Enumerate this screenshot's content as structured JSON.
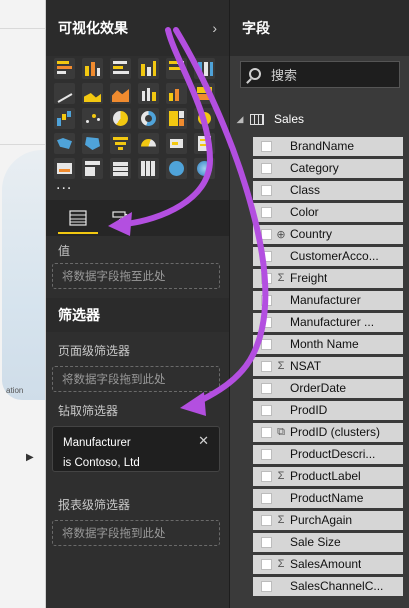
{
  "visualizations": {
    "title": "可视化效果",
    "more": "...",
    "values_label": "值",
    "values_drop": "将数据字段拖至此处",
    "filters_title": "筛选器",
    "page_filters_label": "页面级筛选器",
    "page_filters_drop": "将数据字段拖到此处",
    "drill_filters_label": "钻取筛选器",
    "drill_filter_card": {
      "field": "Manufacturer",
      "condition": "is Contoso, Ltd"
    },
    "report_filters_label": "报表级筛选器",
    "report_filters_drop": "将数据字段拖到此处"
  },
  "fields_pane": {
    "title": "字段",
    "search_placeholder": "搜索",
    "table_name": "Sales",
    "fields": [
      {
        "name": "BrandName",
        "glyph": ""
      },
      {
        "name": "Category",
        "glyph": ""
      },
      {
        "name": "Class",
        "glyph": ""
      },
      {
        "name": "Color",
        "glyph": ""
      },
      {
        "name": "Country",
        "glyph": "globe"
      },
      {
        "name": "CustomerAcco...",
        "glyph": ""
      },
      {
        "name": "Freight",
        "glyph": "sum"
      },
      {
        "name": "Manufacturer",
        "glyph": ""
      },
      {
        "name": "Manufacturer ...",
        "glyph": ""
      },
      {
        "name": "Month Name",
        "glyph": ""
      },
      {
        "name": "NSAT",
        "glyph": "sum"
      },
      {
        "name": "OrderDate",
        "glyph": ""
      },
      {
        "name": "ProdID",
        "glyph": ""
      },
      {
        "name": "ProdID (clusters)",
        "glyph": "cluster"
      },
      {
        "name": "ProductDescri...",
        "glyph": ""
      },
      {
        "name": "ProductLabel",
        "glyph": "sum"
      },
      {
        "name": "ProductName",
        "glyph": ""
      },
      {
        "name": "PurchAgain",
        "glyph": "sum"
      },
      {
        "name": "Sale Size",
        "glyph": ""
      },
      {
        "name": "SalesAmount",
        "glyph": "sum"
      },
      {
        "name": "SalesChannelC...",
        "glyph": ""
      }
    ]
  },
  "canvas": {
    "map_label": "ation"
  },
  "colors": {
    "accent_yellow": "#f2c811",
    "annotation_purple": "#b34fe0",
    "pane_dark": "#2f2f2f"
  }
}
